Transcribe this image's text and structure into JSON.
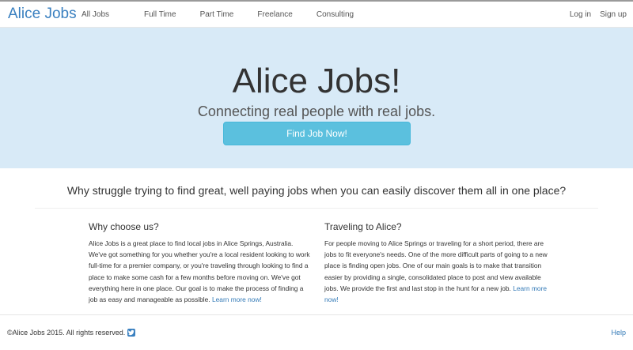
{
  "nav": {
    "brand": "Alice Jobs",
    "links": [
      "All Jobs",
      "Full Time",
      "Part Time",
      "Freelance",
      "Consulting"
    ],
    "login": "Log in",
    "signup": "Sign up"
  },
  "hero": {
    "title": "Alice Jobs!",
    "subtitle": "Connecting real people with real jobs.",
    "button": "Find Job Now!"
  },
  "lead": "Why struggle trying to find great, well paying jobs when you can easily discover them all in one place?",
  "features": [
    {
      "heading": "Why choose us?",
      "body": "Alice Jobs is a great place to find local jobs in Alice Springs, Australia. We've got something for you whether you're a local resident looking to work full-time for a premier company, or you're traveling through looking to find a place to make some cash for a few months before moving on. We've got everything here in one place. Our goal is to make the process of finding a job as easy and manageable as possible.",
      "link": "Learn more now!"
    },
    {
      "heading": "Traveling to Alice?",
      "body": "For people moving to Alice Springs or traveling for a short period, there are jobs to fit everyone's needs. One of the more difficult parts of going to a new place is finding open jobs. One of our main goals is to make that transition easier by providing a single, consolidated place to post and view available jobs. We provide the first and last stop in the hunt for a new job.",
      "link": "Learn more now!"
    }
  ],
  "footer": {
    "copyright": "©Alice Jobs 2015. All rights reserved.",
    "social_icon": "twitter-icon",
    "help": "Help"
  },
  "colors": {
    "brand": "#3a80c0",
    "hero_bg": "#d8eaf7",
    "button": "#5bc0de",
    "link": "#337ab7"
  }
}
